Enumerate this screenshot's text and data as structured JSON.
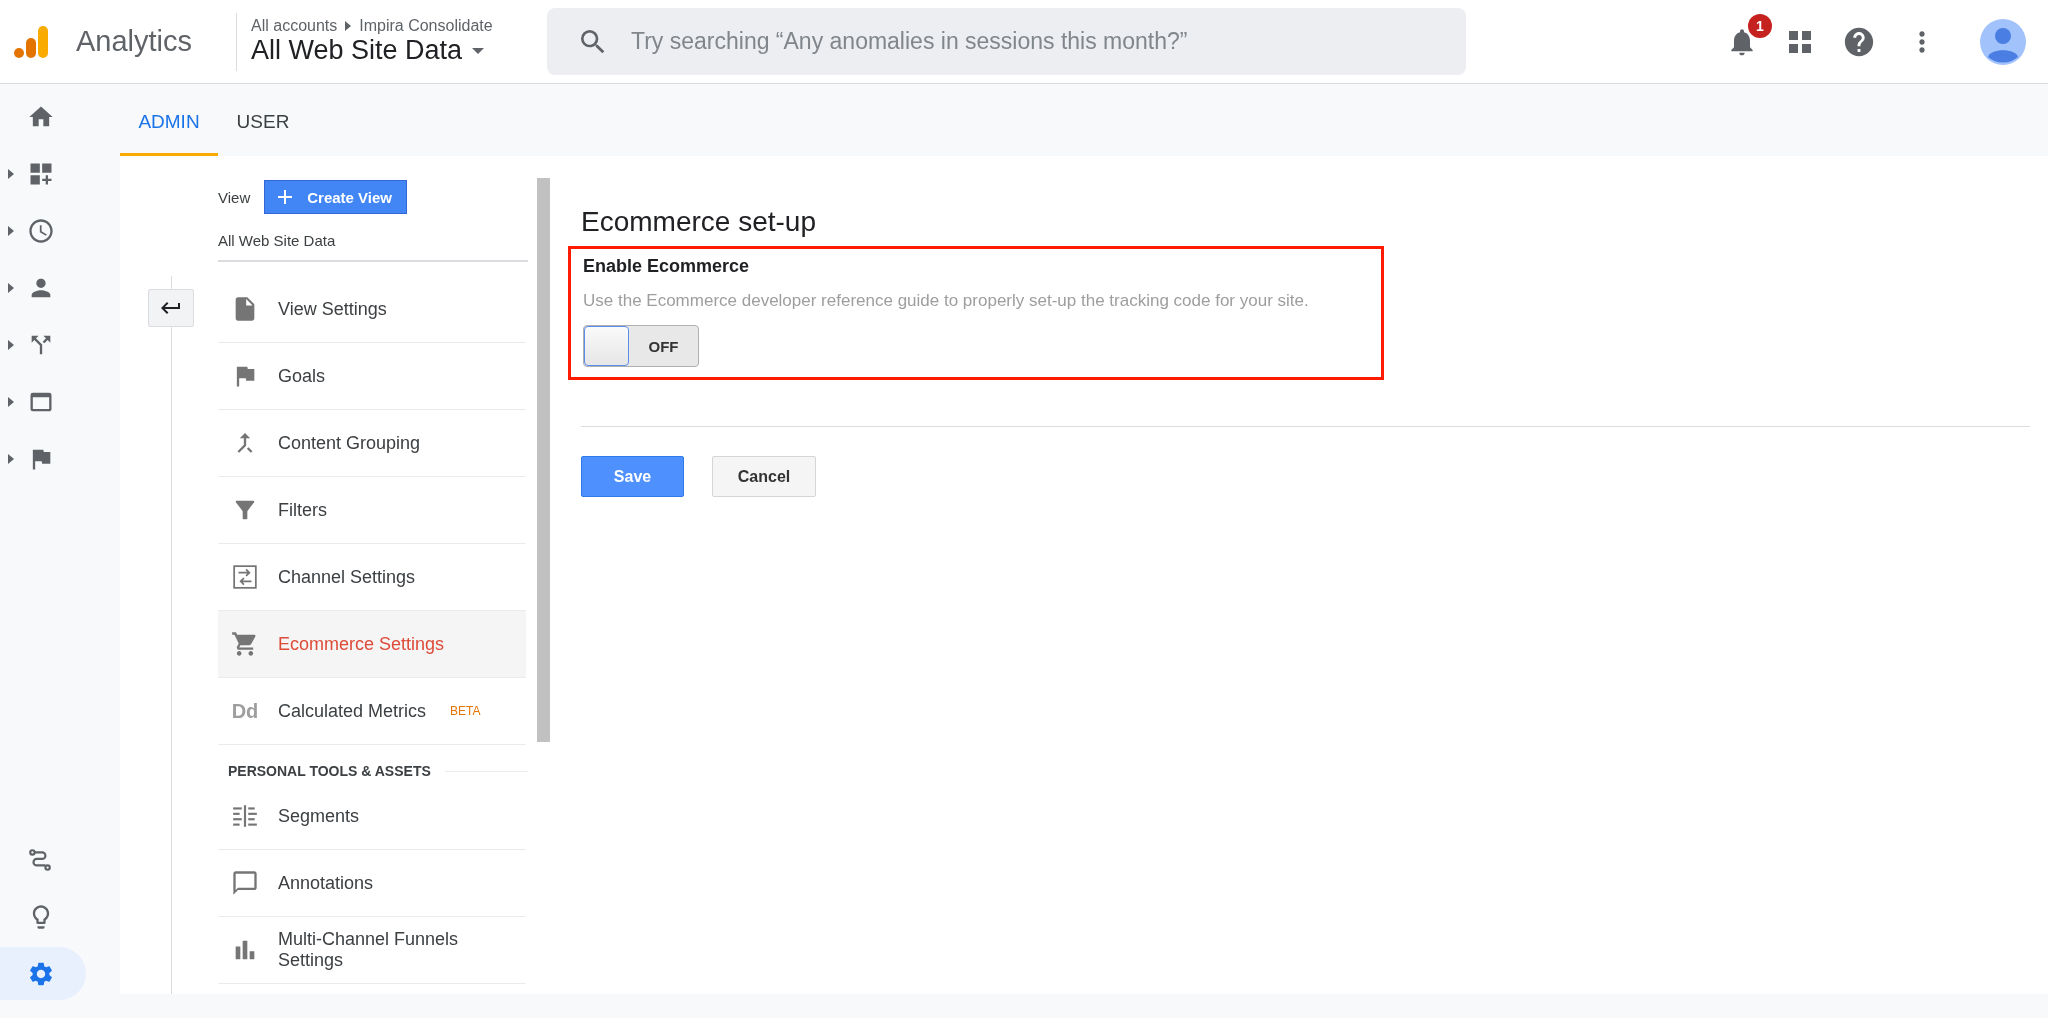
{
  "header": {
    "app_name": "Analytics",
    "breadcrumb": [
      "All accounts",
      "Impira Consolidate"
    ],
    "property": "All Web Site Data",
    "search": {
      "placeholder": "Try searching “Any anomalies in sessions this month?”"
    },
    "notifications": {
      "count": "1"
    }
  },
  "nav_rail": {
    "top_items": [
      {
        "expandable": false,
        "selected": false
      },
      {
        "expandable": true,
        "selected": false
      },
      {
        "expandable": true,
        "selected": false
      },
      {
        "expandable": true,
        "selected": false
      },
      {
        "expandable": true,
        "selected": false
      },
      {
        "expandable": true,
        "selected": false
      },
      {
        "expandable": true,
        "selected": false
      }
    ],
    "bottom_items": [
      {
        "selected": false
      },
      {
        "selected": false
      },
      {
        "selected": true
      }
    ]
  },
  "tabs": [
    {
      "label": "ADMIN",
      "selected": true
    },
    {
      "label": "USER",
      "selected": false
    }
  ],
  "admin_menu": {
    "view_label": "View",
    "create_button": "Create View",
    "view_name": "All Web Site Data",
    "items": [
      {
        "label": "View Settings",
        "selected": false
      },
      {
        "label": "Goals",
        "selected": false
      },
      {
        "label": "Content Grouping",
        "selected": false
      },
      {
        "label": "Filters",
        "selected": false
      },
      {
        "label": "Channel Settings",
        "selected": false
      },
      {
        "label": "Ecommerce Settings",
        "selected": true
      },
      {
        "label": "Calculated Metrics",
        "selected": false,
        "icon_text": "Dd",
        "badge": "BETA"
      }
    ],
    "section_title": "PERSONAL TOOLS & ASSETS",
    "personal_items": [
      {
        "label": "Segments",
        "selected": false
      },
      {
        "label": "Annotations",
        "selected": false
      },
      {
        "label": "Multi-Channel Funnels Settings",
        "selected": false
      }
    ]
  },
  "panel": {
    "title": "Ecommerce set-up",
    "highlighted": true,
    "setting_label": "Enable Ecommerce",
    "description": "Use the Ecommerce developer reference guide to properly set-up the tracking code for your site.",
    "toggle": {
      "label": "OFF",
      "on": false
    },
    "buttons": [
      {
        "label": "Save",
        "kind": "primary"
      },
      {
        "label": "Cancel",
        "kind": "secondary"
      }
    ]
  }
}
